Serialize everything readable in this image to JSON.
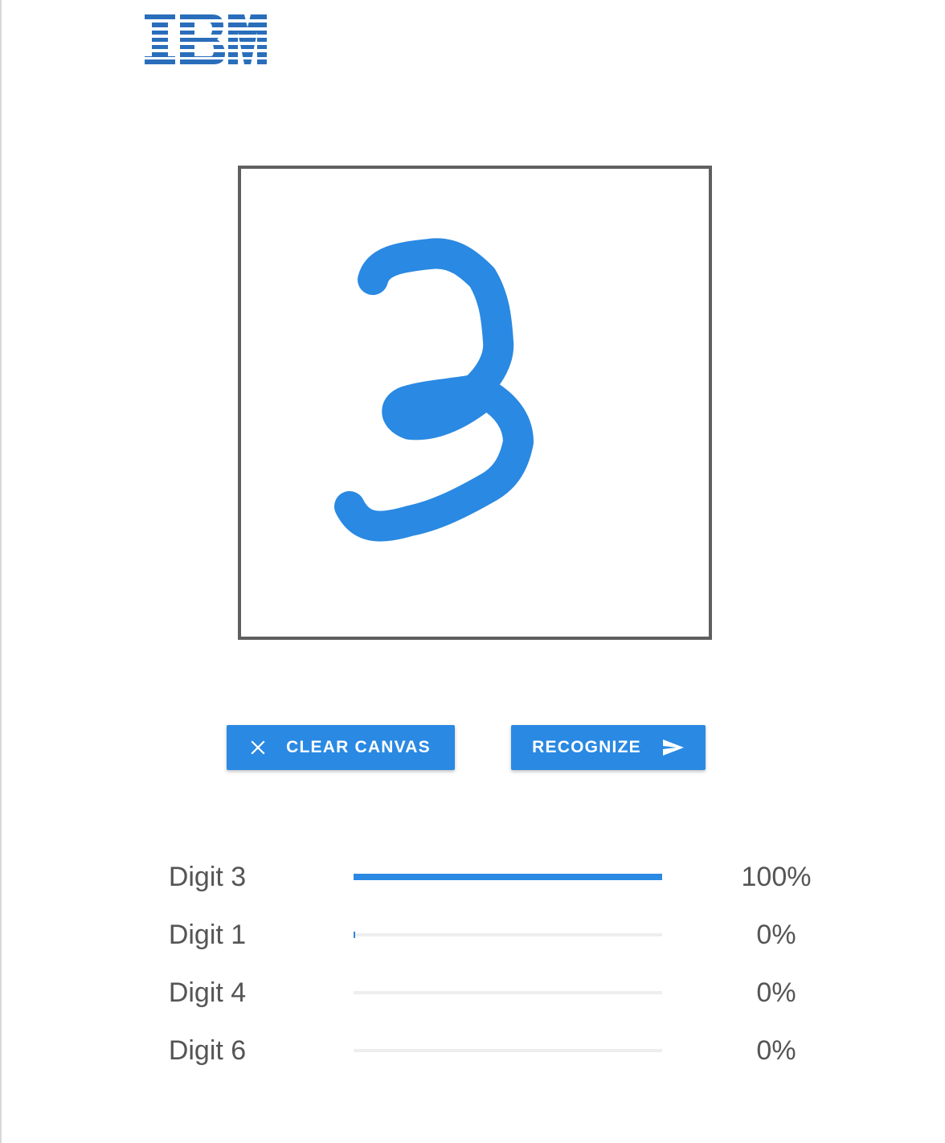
{
  "header": {
    "logo_text": "IBM",
    "logo_color": "#2a6ebb"
  },
  "canvas": {
    "stroke_color": "#2a89e2"
  },
  "actions": {
    "clear_label": "CLEAR CANVAS",
    "clear_icon": "close-icon",
    "recognize_label": "RECOGNIZE",
    "recognize_icon": "send-icon",
    "button_color": "#2a89e2"
  },
  "results": [
    {
      "label": "Digit 3",
      "percent_text": "100%",
      "value": 1.0
    },
    {
      "label": "Digit 1",
      "percent_text": "0%",
      "value": 0.005
    },
    {
      "label": "Digit 4",
      "percent_text": "0%",
      "value": 0.0
    },
    {
      "label": "Digit 6",
      "percent_text": "0%",
      "value": 0.0
    }
  ]
}
